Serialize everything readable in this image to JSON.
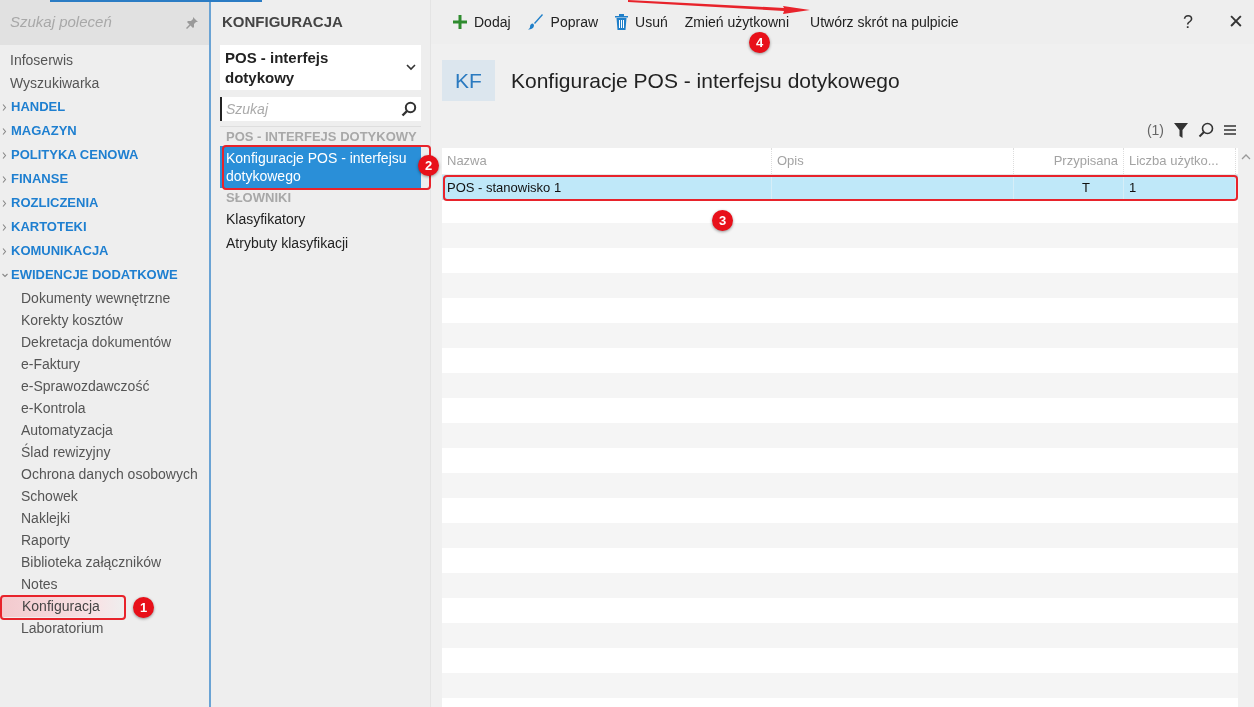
{
  "sidebar": {
    "search_placeholder": "Szukaj poleceń",
    "items": [
      {
        "kind": "link",
        "label": "Infoserwis",
        "selected": false
      },
      {
        "kind": "link",
        "label": "Wyszukiwarka",
        "selected": false
      },
      {
        "kind": "section",
        "label": "HANDEL",
        "expanded": false
      },
      {
        "kind": "section",
        "label": "MAGAZYN",
        "expanded": false
      },
      {
        "kind": "section",
        "label": "POLITYKA CENOWA",
        "expanded": false
      },
      {
        "kind": "section",
        "label": "FINANSE",
        "expanded": false
      },
      {
        "kind": "section",
        "label": "ROZLICZENIA",
        "expanded": false
      },
      {
        "kind": "section",
        "label": "KARTOTEKI",
        "expanded": false
      },
      {
        "kind": "section",
        "label": "KOMUNIKACJA",
        "expanded": false
      },
      {
        "kind": "section",
        "label": "EWIDENCJE DODATKOWE",
        "expanded": true,
        "children": [
          {
            "label": "Dokumenty wewnętrzne",
            "selected": false
          },
          {
            "label": "Korekty kosztów",
            "selected": false
          },
          {
            "label": "Dekretacja dokumentów",
            "selected": false
          },
          {
            "label": "e-Faktury",
            "selected": false
          },
          {
            "label": "e-Sprawozdawczość",
            "selected": false
          },
          {
            "label": "e-Kontrola",
            "selected": false
          },
          {
            "label": "Automatyzacja",
            "selected": false
          },
          {
            "label": "Ślad rewizyjny",
            "selected": false
          },
          {
            "label": "Ochrona danych osobowych",
            "selected": false
          },
          {
            "label": "Schowek",
            "selected": false
          },
          {
            "label": "Naklejki",
            "selected": false
          },
          {
            "label": "Raporty",
            "selected": false
          },
          {
            "label": "Biblioteka załączników",
            "selected": false
          },
          {
            "label": "Notes",
            "selected": false
          },
          {
            "label": "Konfiguracja",
            "selected": true
          },
          {
            "label": "Laboratorium",
            "selected": false
          }
        ]
      }
    ]
  },
  "middle": {
    "title": "KONFIGURACJA",
    "dropdown": "POS - interfejs dotykowy",
    "search_placeholder": "Szukaj",
    "groups": [
      {
        "heading": "POS - INTERFEJS DOTYKOWY",
        "items": [
          {
            "label": "Konfiguracje POS - interfejsu dotykowego",
            "selected": true
          }
        ]
      },
      {
        "heading": "SŁOWNIKI",
        "items": [
          {
            "label": "Klasyfikatory",
            "selected": false
          },
          {
            "label": "Atrybuty klasyfikacji",
            "selected": false
          }
        ]
      }
    ]
  },
  "toolbar": [
    {
      "kind": "add",
      "label": "Dodaj"
    },
    {
      "kind": "edit",
      "label": "Popraw"
    },
    {
      "kind": "delete",
      "label": "Usuń"
    },
    {
      "kind": "text",
      "label": "Zmień użytkowni"
    },
    {
      "kind": "text",
      "label": "Utwórz skrót na pulpicie"
    }
  ],
  "help": "?",
  "close": "✕",
  "header": {
    "badge": "KF",
    "title": "Konfiguracje POS - interfejsu dotykowego"
  },
  "grid_tools": {
    "count": "(1)"
  },
  "table": {
    "columns": [
      "Nazwa",
      "Opis",
      "Przypisana",
      "Liczba użytko..."
    ],
    "rows": [
      {
        "cells": [
          "POS - stanowisko 1",
          "",
          "T",
          "1"
        ],
        "selected": true
      }
    ]
  },
  "annotations": [
    {
      "number": "1"
    },
    {
      "number": "2"
    },
    {
      "number": "3"
    },
    {
      "number": "4"
    }
  ]
}
